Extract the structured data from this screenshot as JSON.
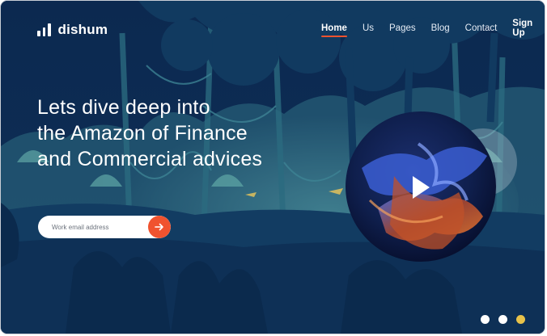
{
  "brand": {
    "name": "dishum",
    "icon": "signal-bars-icon"
  },
  "nav": {
    "items": [
      {
        "label": "Home",
        "active": true
      },
      {
        "label": "Us",
        "active": false
      },
      {
        "label": "Pages",
        "active": false
      },
      {
        "label": "Blog",
        "active": false
      },
      {
        "label": "Contact",
        "active": false
      }
    ],
    "signup_label": "Sign Up"
  },
  "hero": {
    "headline_lines": [
      "Lets dive deep into",
      "the Amazon of Finance",
      "and Commercial advices"
    ],
    "email_placeholder": "Work email address",
    "submit_icon": "arrow-right-icon",
    "video_icon": "play-icon"
  },
  "carousel": {
    "dot_count": 3,
    "active_index": 2
  },
  "colors": {
    "background": "#0d2a52",
    "accent": "#f0532f",
    "active_dot": "#e8c24a",
    "forest_far": "#3d7f8f",
    "forest_mid": "#1d5170",
    "forest_near": "#10375d"
  }
}
